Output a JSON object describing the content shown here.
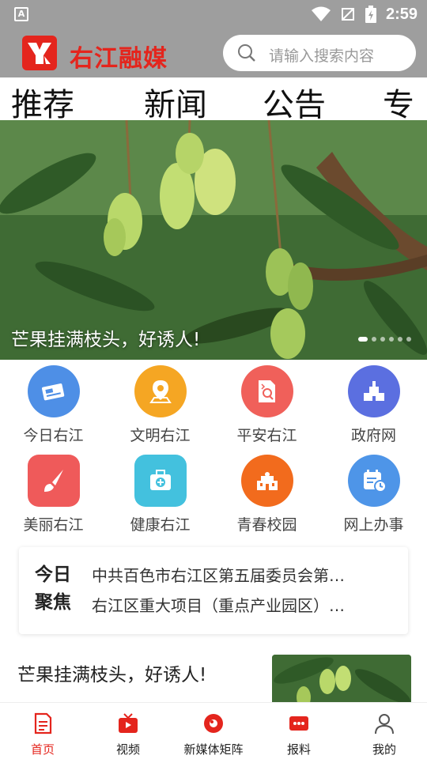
{
  "status_bar": {
    "time": "2:59",
    "left_icon": "A"
  },
  "header": {
    "brand": "右江融媒",
    "search_placeholder": "请输入搜索内容"
  },
  "tabs": [
    "推荐",
    "新闻",
    "公告",
    "专题"
  ],
  "banner": {
    "caption": "芒果挂满枝头，好诱人!",
    "slide_count": 6,
    "active_slide": 0
  },
  "grid": [
    {
      "label": "今日右江",
      "icon": "newspaper-icon",
      "color": "#4e8fe6"
    },
    {
      "label": "文明右江",
      "icon": "location-pin-icon",
      "color": "#f5a623"
    },
    {
      "label": "平安右江",
      "icon": "document-search-icon",
      "color": "#f0605a"
    },
    {
      "label": "政府网",
      "icon": "government-building-icon",
      "color": "#5b6fe0"
    },
    {
      "label": "美丽右江",
      "icon": "paintbrush-icon",
      "color": "#ef5a5a"
    },
    {
      "label": "健康右江",
      "icon": "medical-kit-icon",
      "color": "#43c1de"
    },
    {
      "label": "青春校园",
      "icon": "school-icon",
      "color": "#f26b1d"
    },
    {
      "label": "网上办事",
      "icon": "calendar-clock-icon",
      "color": "#4e95e8"
    }
  ],
  "focus": {
    "tag_line1": "今日",
    "tag_line2": "聚焦",
    "items": [
      "中共百色市右江区第五届委员会第…",
      "右江区重大项目（重点产业园区）…"
    ]
  },
  "news": {
    "title": "芒果挂满枝头，好诱人!"
  },
  "bottom_nav": [
    {
      "label": "首页",
      "icon": "home-doc-icon",
      "active": true
    },
    {
      "label": "视频",
      "icon": "tv-icon",
      "active": false
    },
    {
      "label": "新媒体矩阵",
      "icon": "media-circle-icon",
      "active": false
    },
    {
      "label": "报料",
      "icon": "report-icon",
      "active": false
    },
    {
      "label": "我的",
      "icon": "user-icon",
      "active": false
    }
  ],
  "colors": {
    "accent": "#e4251d",
    "header_bg": "#9e9e9e"
  }
}
